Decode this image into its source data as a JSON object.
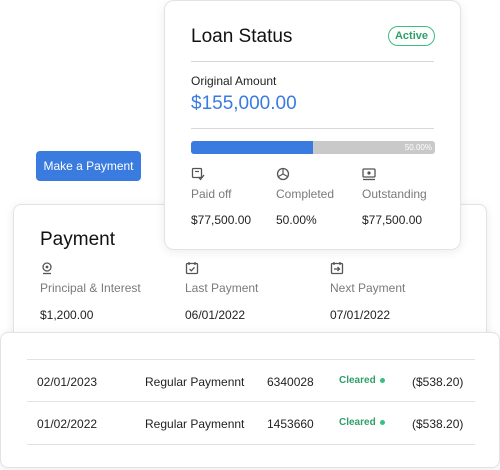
{
  "loan_status": {
    "title": "Loan Status",
    "status_badge": "Active",
    "original_amount_label": "Original Amount",
    "original_amount": "$155,000.00",
    "progress_fraction": 0.5,
    "progress_label": "50.00%",
    "stats": [
      {
        "icon": "paid-off-icon",
        "label": "Paid off",
        "value": "$77,500.00"
      },
      {
        "icon": "completed-icon",
        "label": "Completed",
        "value": "50.00%"
      },
      {
        "icon": "outstanding-icon",
        "label": "Outstanding",
        "value": "$77,500.00"
      }
    ]
  },
  "actions": {
    "make_payment_label": "Make a Payment"
  },
  "payment": {
    "title": "Payment",
    "items": [
      {
        "icon": "principal-icon",
        "label": "Principal & Interest",
        "value": "$1,200.00"
      },
      {
        "icon": "calendar-check-icon",
        "label": "Last Payment",
        "value": "06/01/2022"
      },
      {
        "icon": "next-payment-icon",
        "label": "Next Payment",
        "value": "07/01/2022"
      }
    ]
  },
  "transactions": [
    {
      "date": "02/01/2023",
      "type": "Regular Paymennt",
      "ref": "6340028",
      "status": "Cleared",
      "amount": "($538.20)"
    },
    {
      "date": "01/02/2022",
      "type": "Regular Paymennt",
      "ref": "1453660",
      "status": "Cleared",
      "amount": "($538.20)"
    }
  ],
  "colors": {
    "accent": "#3a7be0",
    "success": "#3bbf80",
    "track": "#c9c9c9"
  }
}
